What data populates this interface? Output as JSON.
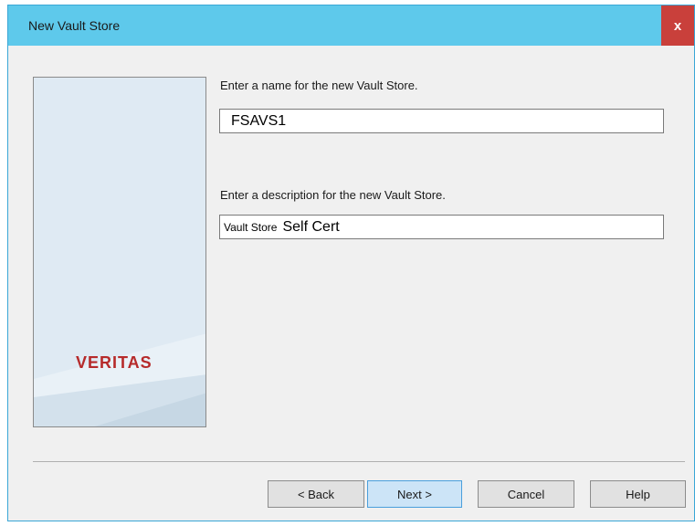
{
  "window": {
    "title": "New Vault Store",
    "close_label": "x"
  },
  "side_panel": {
    "logo_text": "VERITAS"
  },
  "name_section": {
    "prompt": "Enter a name for the new Vault Store.",
    "value": "FSAVS1"
  },
  "description_section": {
    "prompt": "Enter a description for the new Vault Store.",
    "value_prefix": "Vault Store",
    "value_main": "Self Cert"
  },
  "buttons": {
    "back": "< Back",
    "next": "Next >",
    "cancel": "Cancel",
    "help": "Help"
  },
  "colors": {
    "titlebar": "#5ec9eb",
    "close": "#c9403b",
    "logo": "#b62a2a",
    "primary_button": "#cce4f7"
  }
}
